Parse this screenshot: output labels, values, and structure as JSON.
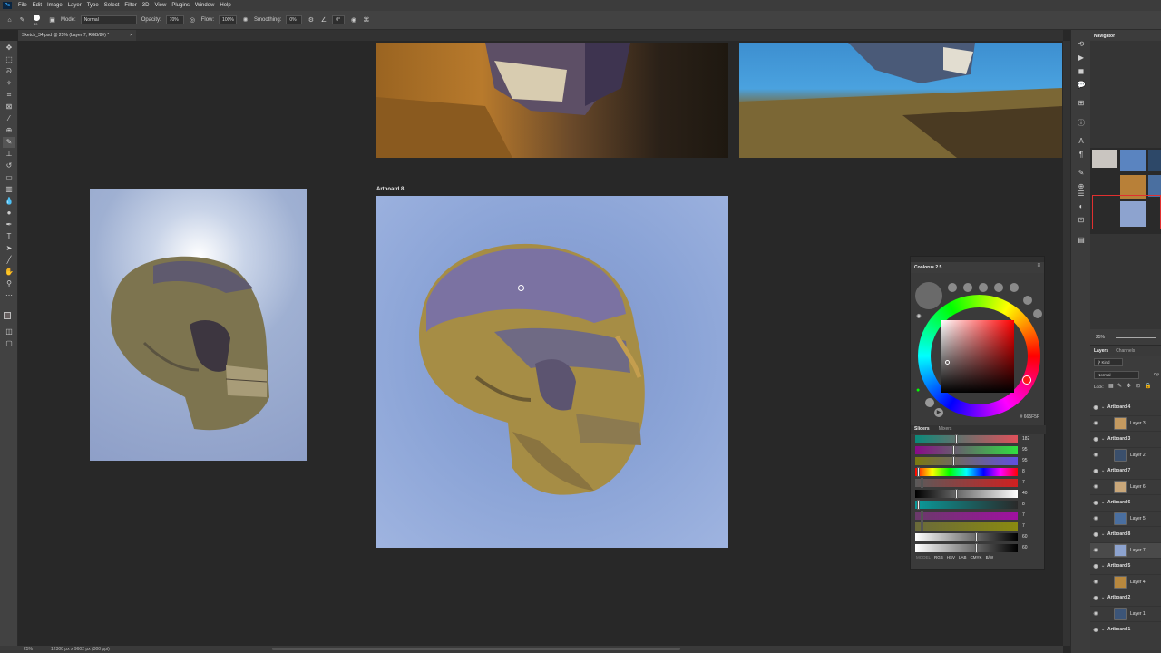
{
  "app": {
    "logo": "Ps",
    "menu": [
      "File",
      "Edit",
      "Image",
      "Layer",
      "Type",
      "Select",
      "Filter",
      "3D",
      "View",
      "Plugins",
      "Window",
      "Help"
    ]
  },
  "options": {
    "mode_label": "Mode:",
    "mode_value": "Normal",
    "opacity_label": "Opacity:",
    "opacity_value": "70%",
    "flow_label": "Flow:",
    "flow_value": "100%",
    "smoothing_label": "Smoothing:",
    "smoothing_value": "0%",
    "angle_value": "0°",
    "brush_size": "30"
  },
  "document": {
    "tab_title": "Sketch_34.psd @ 25% (Layer 7, RGB/8#) *",
    "artboard_label": "Artboard 8"
  },
  "status": {
    "zoom": "25%",
    "doc_size": "12300 px x 9602 px (300 ppi)"
  },
  "navigator": {
    "title": "Navigator",
    "zoom": "25%"
  },
  "layers": {
    "tab_layers": "Layers",
    "tab_channels": "Channels",
    "filter_kind": "Kind",
    "blend_mode": "Normal",
    "opacity_abbr": "Op",
    "lock_label": "Lock:",
    "items": [
      {
        "name": "Artboard 4",
        "type": "group"
      },
      {
        "name": "Layer 3",
        "type": "layer",
        "thumb": "#c49a60"
      },
      {
        "name": "Artboard 3",
        "type": "group"
      },
      {
        "name": "Layer 2",
        "type": "layer",
        "thumb": "#3a4f6c"
      },
      {
        "name": "Artboard 7",
        "type": "group"
      },
      {
        "name": "Layer 6",
        "type": "layer",
        "thumb": "#c9a77a"
      },
      {
        "name": "Artboard 6",
        "type": "group"
      },
      {
        "name": "Layer 5",
        "type": "layer",
        "thumb": "#4a6fa0"
      },
      {
        "name": "Artboard 8",
        "type": "group"
      },
      {
        "name": "Layer 7",
        "type": "layer",
        "thumb": "#8da3cf",
        "selected": true
      },
      {
        "name": "Artboard 5",
        "type": "group"
      },
      {
        "name": "Layer 4",
        "type": "layer",
        "thumb": "#b8883e"
      },
      {
        "name": "Artboard 2",
        "type": "group"
      },
      {
        "name": "Layer 1",
        "type": "layer",
        "thumb": "#3c5578"
      },
      {
        "name": "Artboard 1",
        "type": "group"
      }
    ]
  },
  "coolorus": {
    "title": "Coolorus 2.5",
    "hex": "# 665F5F",
    "tab_sliders": "Sliders",
    "tab_mixers": "Mixers",
    "slider_values": [
      "182",
      "95",
      "95",
      "8",
      "7",
      "40",
      "8",
      "7",
      "7",
      "60",
      "60"
    ],
    "modes_label": "MODEL",
    "modes": [
      "RGB",
      "HSV",
      "LAB",
      "CMYK",
      "B/W"
    ]
  },
  "colors": {
    "fg": "#665f5f",
    "bg": "#ffffff",
    "sky": "#8da6d6"
  }
}
